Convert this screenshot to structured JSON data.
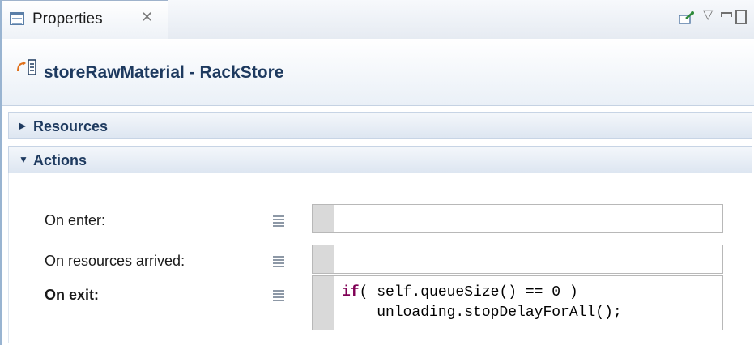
{
  "tab": {
    "label": "Properties",
    "close_glyph": "✕"
  },
  "view_controls": {
    "icons": [
      "pin-icon",
      "view-menu-icon",
      "minimize-icon",
      "maximize-icon"
    ]
  },
  "header": {
    "title": "storeRawMaterial - RackStore",
    "icon": "flowchart-block-icon"
  },
  "sections": {
    "resources": {
      "label": "Resources",
      "state": "collapsed"
    },
    "actions": {
      "label": "Actions",
      "state": "expanded"
    }
  },
  "actions": {
    "on_enter": {
      "label": "On enter:",
      "value": ""
    },
    "on_resources_arrived": {
      "label": "On resources arrived:",
      "value": ""
    },
    "on_exit": {
      "label": "On exit:",
      "code_keyword": "if",
      "code_line1_rest": "( self.queueSize() == 0 )",
      "code_line2": "    unloading.stopDelayForAll();"
    }
  },
  "colors": {
    "accent": "#1e3a5f",
    "keyword": "#7f0055",
    "border": "#99b4d1"
  }
}
